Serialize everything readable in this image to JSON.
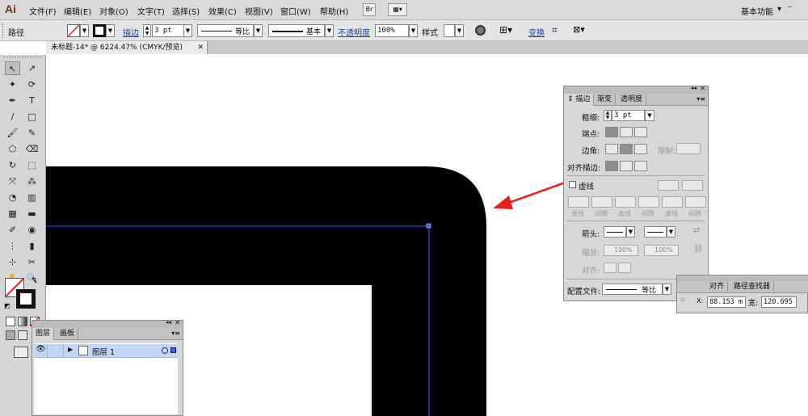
{
  "app": {
    "logo": "Ai",
    "workspace": "基本功能",
    "workspace_arrow": "▾"
  },
  "menu": [
    "文件(F)",
    "编辑(E)",
    "对象(O)",
    "文字(T)",
    "选择(S)",
    "效果(C)",
    "视图(V)",
    "窗口(W)",
    "帮助(H)"
  ],
  "bridge_label": "Br",
  "window_controls": {
    "minimize": "–",
    "restore": "▫",
    "close": "✕"
  },
  "control": {
    "selection_label": "路径",
    "stroke_label": "描边",
    "stroke_weight": "3 pt",
    "profile1": "等比",
    "profile2": "基本",
    "opacity_label": "不透明度",
    "opacity_value": "100%",
    "style_label": "样式",
    "transform_label": "变换"
  },
  "document_tab": {
    "title": "未标题-14* @ 6224.47% (CMYK/预览)",
    "close": "✕"
  },
  "tools": [
    "↖",
    "↗",
    "✦",
    "⟳",
    "✒",
    "T",
    "/",
    "□",
    "🖌",
    "✎",
    "⬠",
    "⌫",
    "↻",
    "⬚",
    "⤧",
    "⁂",
    "◔",
    "▥",
    "▦",
    "▬",
    "✐",
    "◉",
    "⋮",
    "▮",
    "⊹",
    "✂",
    "✋",
    "🔍"
  ],
  "stroke_panel": {
    "tabs": [
      "描边",
      "渐变",
      "透明度"
    ],
    "weight_label": "粗细:",
    "weight_value": "3 pt",
    "cap_label": "端点:",
    "corner_label": "边角:",
    "limit_label": "限制:",
    "align_label": "对齐描边:",
    "dashed_label": "虚线",
    "dash_labels": [
      "虚线",
      "间隙",
      "虚线",
      "间隙",
      "虚线",
      "间隙"
    ],
    "arrow_label": "箭头:",
    "scale_label": "缩放:",
    "scale_value1": "100%",
    "scale_value2": "100%",
    "align_arrows_label": "对齐:",
    "profile_label": "配置文件:",
    "profile_value": "等比"
  },
  "align_panel": {
    "tabs": [
      "对齐",
      "路径查找器"
    ],
    "x_value": "88.153 m",
    "w_label": "宽:",
    "w_value": "120.695"
  },
  "layers_panel": {
    "tabs": [
      "图层",
      "画板"
    ],
    "layer_name": "图层 1"
  },
  "colors": {
    "selection": "#3d5bff",
    "arrow": "#e8201e",
    "black": "#000000"
  }
}
